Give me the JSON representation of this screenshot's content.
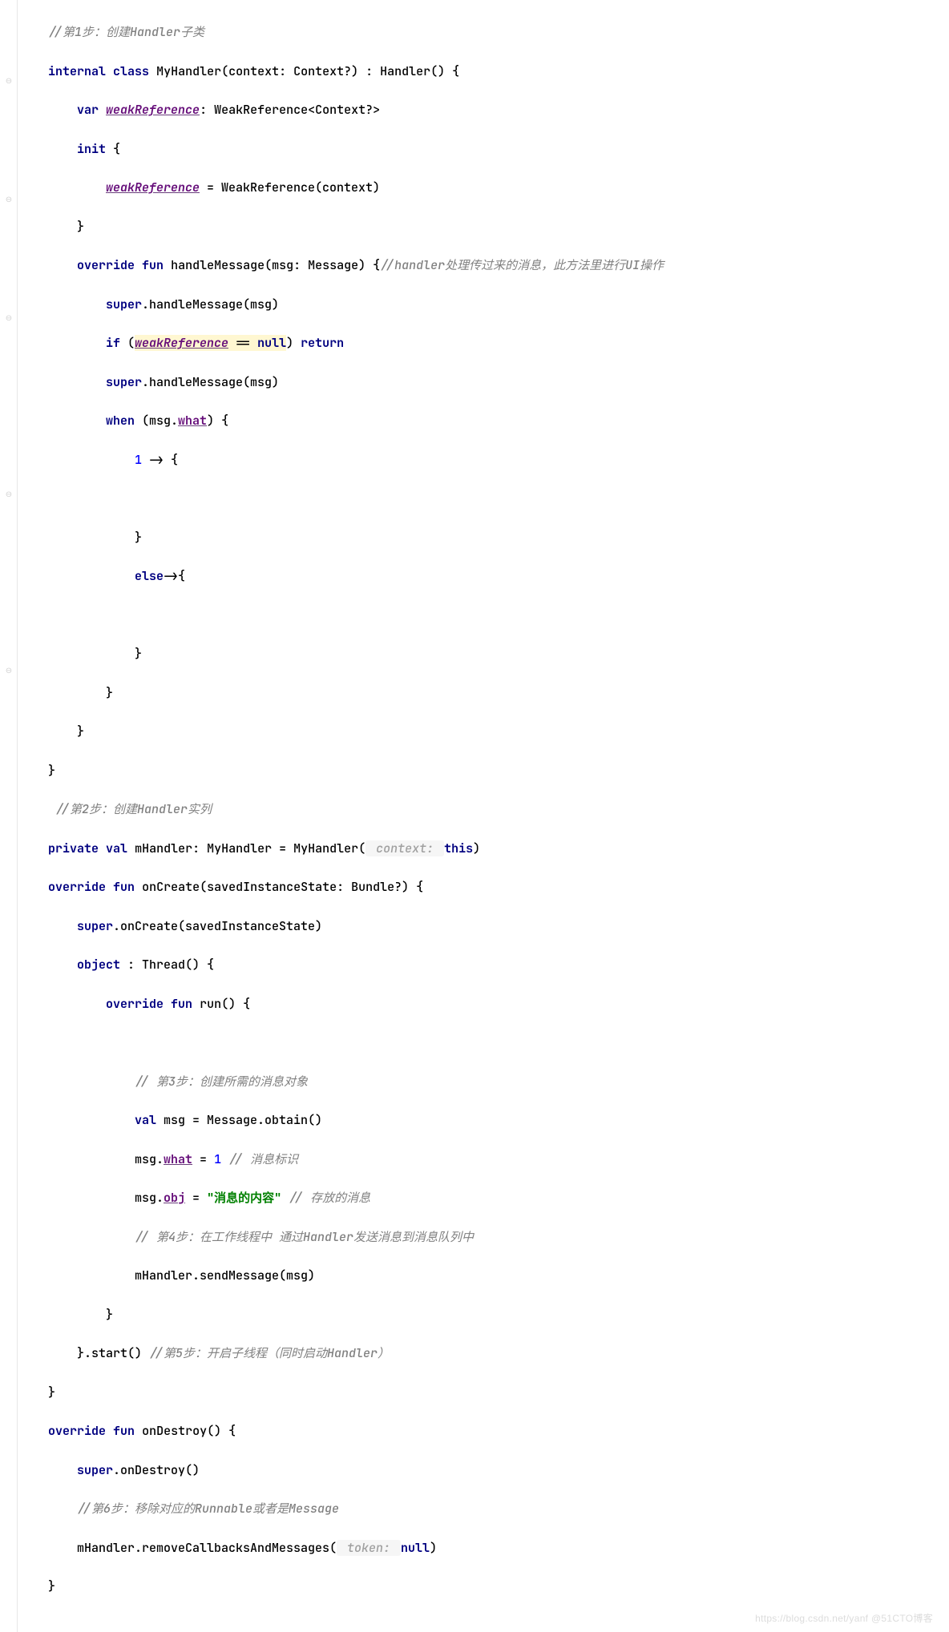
{
  "code": {
    "l1": {
      "c1_cmt": "//第1步：创建Handler子类"
    },
    "l2": {
      "kw1": "internal",
      "kw2": "class",
      "cls": "MyHandler(context: Context?) : Handler() {"
    },
    "l3": {
      "kw": "var",
      "name": "weakReference",
      "rest": ": WeakReference<Context?>"
    },
    "l4": {
      "kw": "init",
      "br": " {"
    },
    "l5": {
      "name": "weakReference",
      "rest": " = WeakReference(context)"
    },
    "l6": {
      "br": "}"
    },
    "l7": {
      "kw1": "override",
      "kw2": "fun",
      "sig": "handleMessage(msg: Message) {",
      "cmt": "//handler处理传过来的消息，此方法里进行UI操作"
    },
    "l8": {
      "kw": "super",
      "rest": ".handleMessage(msg)"
    },
    "l9": {
      "kw1": "if",
      "op": " (",
      "name": "weakReference",
      "eq": " == ",
      "nll": "null",
      "cl": ") ",
      "kw2": "return"
    },
    "l10": {
      "kw": "super",
      "rest": ".handleMessage(msg)"
    },
    "l11": {
      "kw": "when",
      "op": " (msg.",
      "name": "what",
      "cl": ") {"
    },
    "l12": {
      "num": "1",
      "rest": " -> {"
    },
    "l13": {
      "blank": ""
    },
    "l14": {
      "br": "}"
    },
    "l15": {
      "kw": "else",
      "rest": "->{"
    },
    "l16": {
      "blank": ""
    },
    "l17": {
      "br": "}"
    },
    "l18": {
      "br": "}"
    },
    "l19": {
      "br": "}"
    },
    "l20": {
      "br": "}"
    },
    "l21": {
      "cmt": " //第2步：创建Handler实列"
    },
    "l22": {
      "kw1": "private",
      "kw2": "val",
      "name": "mHandler",
      "rest1": ": MyHandler = MyHandler(",
      "hint": " context: ",
      "kw3": "this",
      "rest2": ")"
    },
    "l23": {
      "kw1": "override",
      "kw2": "fun",
      "sig": "onCreate(savedInstanceState: Bundle?) {"
    },
    "l24": {
      "kw": "super",
      "rest": ".onCreate(savedInstanceState)"
    },
    "l25": {
      "kw": "object",
      "rest": " : Thread() {"
    },
    "l26": {
      "kw1": "override",
      "kw2": "fun",
      "sig": "run() {"
    },
    "l27": {
      "blank": ""
    },
    "l28": {
      "cmt": "// 第3步：创建所需的消息对象"
    },
    "l29": {
      "kw": "val",
      "rest": " msg = Message.obtain()"
    },
    "l30": {
      "pre": "msg.",
      "name": "what",
      "mid": " = ",
      "num": "1",
      "cmt": " // 消息标识"
    },
    "l31": {
      "pre": "msg.",
      "name": "obj",
      "mid": " = ",
      "str": "\"消息的内容\"",
      "cmt": " // 存放的消息"
    },
    "l32": {
      "cmt": "// 第4步：在工作线程中 通过Handler发送消息到消息队列中"
    },
    "l33": {
      "txt": "mHandler.sendMessage(msg)"
    },
    "l34": {
      "br": "}"
    },
    "l35": {
      "pre": "}.start() ",
      "cmt": "//第5步：开启子线程（同时启动Handler）"
    },
    "l36": {
      "br": "}"
    },
    "l37": {
      "kw1": "override",
      "kw2": "fun",
      "sig": "onDestroy() {"
    },
    "l38": {
      "kw": "super",
      "rest": ".onDestroy()"
    },
    "l39": {
      "cmt": "//第6步：移除对应的Runnable或者是Message"
    },
    "l40": {
      "pre": "mHandler.removeCallbacksAndMessages(",
      "hint": " token: ",
      "kw": "null",
      "post": ")"
    },
    "l41": {
      "br": "}"
    }
  },
  "watermark": "https://blog.csdn.net/yanf @51CTO博客"
}
